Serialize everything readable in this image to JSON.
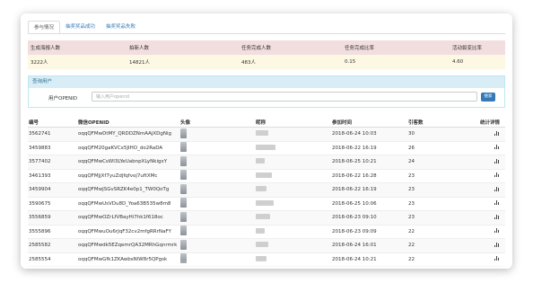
{
  "tabs": [
    "参与情况",
    "抽奖奖品成功",
    "抽奖奖品失败"
  ],
  "summary": {
    "headers": [
      "生成海报人数",
      "拍新人数",
      "任务完成人数",
      "任务完成比率",
      "活动裂变比率"
    ],
    "values": [
      "3222人",
      "14821人",
      "483人",
      "0.15",
      "4.60"
    ]
  },
  "search": {
    "panel_title": "查询用户",
    "label": "用户OPENID",
    "placeholder": "输入用户openid",
    "button": "搜索"
  },
  "table": {
    "headers": [
      "编号",
      "微信OPENID",
      "头像",
      "昵称",
      "参加时间",
      "引客数",
      "统计详情"
    ],
    "rows": [
      {
        "id": "3562741",
        "openid": "oqqQFMwDtMY_QRDDZNmAAjXDgNig",
        "time": "2018-06-24 10:03",
        "count": "30"
      },
      {
        "id": "3459883",
        "openid": "oqqQFM20gaKVCx5JIHO_do2RaDA",
        "time": "2018-06-22 16:19",
        "count": "26"
      },
      {
        "id": "3577402",
        "openid": "oqqQFMwCsWI3LYeUabnpXLyNkigxY",
        "time": "2018-06-25 10:21",
        "count": "24"
      },
      {
        "id": "3461393",
        "openid": "oqqQFMjjXf7yuZdjfqfvoj7uftXMc",
        "time": "2018-06-22 16:28",
        "count": "23"
      },
      {
        "id": "3459904",
        "openid": "oqqQFMwJSGvSRZK4e0p1_TW0QoTg",
        "time": "2018-06-22 16:19",
        "count": "23"
      },
      {
        "id": "3590675",
        "openid": "oqqQFMwUsVDu8D_Yoa63B535w8m8",
        "time": "2018-06-25 10:06",
        "count": "23"
      },
      {
        "id": "3556859",
        "openid": "oqqQFMwOZrLfVBayHi7hk1f618oc",
        "time": "2018-06-23 09:10",
        "count": "23"
      },
      {
        "id": "3555896",
        "openid": "oqqQFMwuOu6rJqF32cv2mfgRRrNaFY",
        "time": "2018-06-23 09:09",
        "count": "22"
      },
      {
        "id": "2585582",
        "openid": "oqqQFMwdk5EZqemrQA32MRhGqnrmrk",
        "time": "2018-06-24 16:01",
        "count": "22"
      },
      {
        "id": "2585554",
        "openid": "oqqQFMwGfk1ZKAwbsNlW8r5QPgsk",
        "time": "2018-06-24 10:21",
        "count": "22"
      }
    ]
  },
  "colors": {
    "summary_header": "#f2dede",
    "summary_values": "#fcf8e3",
    "panel_header": "#d9edf7",
    "primary": "#337ab7"
  }
}
